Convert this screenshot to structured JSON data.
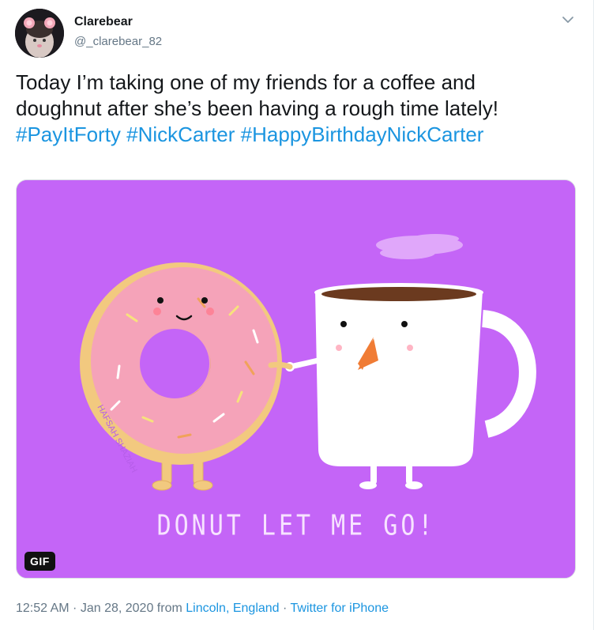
{
  "author": {
    "display_name": "Clarebear",
    "handle": "@_clarebear_82"
  },
  "tweet": {
    "line1": "Today I’m taking one of my friends for a coffee and",
    "line2": "doughnut after she’s been having a rough time lately!",
    "hashtags": [
      "#PayItForty",
      "#NickCarter",
      "#HappyBirthdayNickCarter"
    ]
  },
  "media": {
    "caption": "DONUT LET ME GO!",
    "artist_signature": "HAFSAH SHAZIAH",
    "badge": "GIF",
    "background_color": "#c465f7"
  },
  "meta": {
    "time": "12:52 AM",
    "separator": " · ",
    "date": "Jan 28, 2020",
    "from_label": " from ",
    "location": "Lincoln, England",
    "source": "Twitter for iPhone"
  },
  "colors": {
    "link": "#1b95e0",
    "secondary_text": "#657786",
    "primary_text": "#14171a"
  },
  "icons": {
    "caret": "chevron-down-icon"
  }
}
